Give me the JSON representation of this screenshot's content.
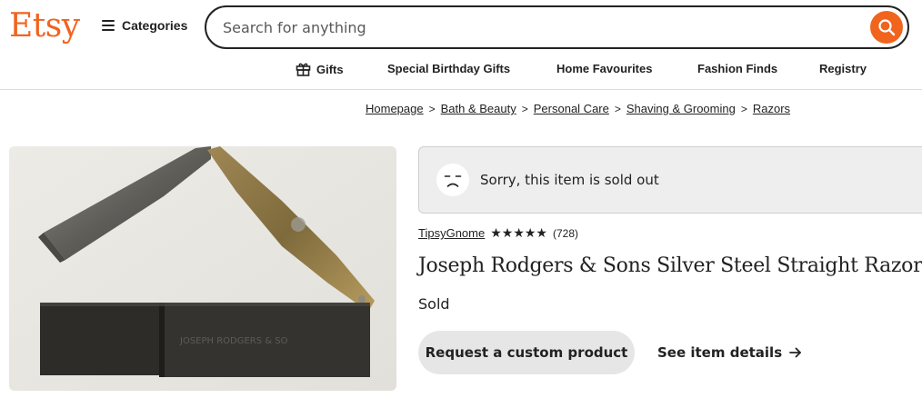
{
  "header": {
    "logo": "Etsy",
    "categories_label": "Categories",
    "search_placeholder": "Search for anything"
  },
  "subnav": [
    "Gifts",
    "Special Birthday Gifts",
    "Home Favourites",
    "Fashion Finds",
    "Registry"
  ],
  "breadcrumb": [
    "Homepage",
    "Bath & Beauty",
    "Personal Care",
    "Shaving & Grooming",
    "Razors"
  ],
  "notice": {
    "text": "Sorry, this item is sold out"
  },
  "listing": {
    "shop_name": "TipsyGnome",
    "stars": "★★★★★",
    "rating_count": "(728)",
    "title": "Joseph Rodgers & Sons Silver Steel Straight Razor",
    "status": "Sold",
    "custom_button": "Request a custom product",
    "details_link": "See item details"
  },
  "colors": {
    "brand": "#f1641e"
  }
}
